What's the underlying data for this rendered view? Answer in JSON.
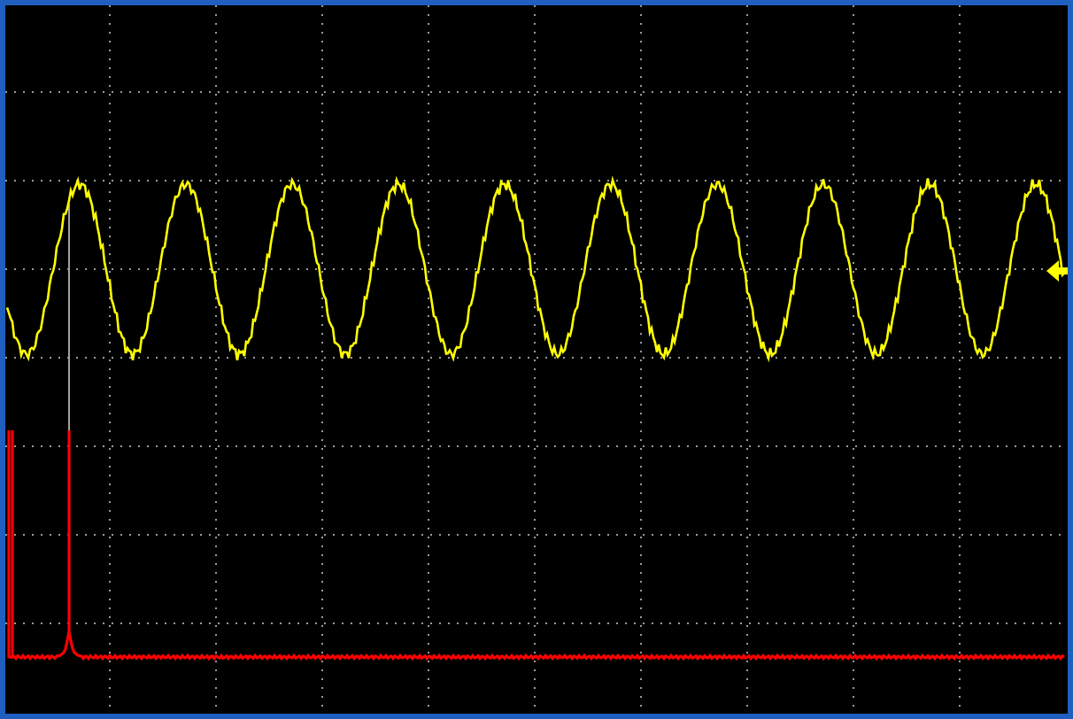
{
  "screen": {
    "traces": [
      {
        "kind": "waveform",
        "color": "#ffff00"
      },
      {
        "kind": "spectrum",
        "color": "#ff0000"
      }
    ],
    "trigger_marker": {
      "color": "#ffff00"
    }
  }
}
